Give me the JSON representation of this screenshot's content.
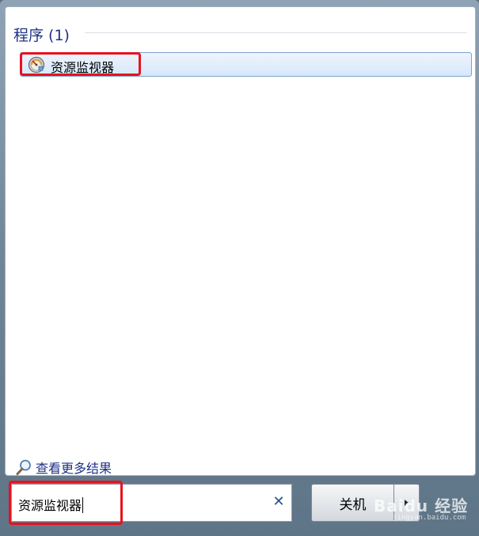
{
  "results": {
    "group_title": "程序 (1)",
    "items": [
      {
        "label": "资源监视器",
        "icon": "resource-monitor-icon"
      }
    ]
  },
  "see_more": {
    "label": "查看更多结果",
    "icon": "search-icon"
  },
  "search": {
    "value": "资源监视器",
    "clear_icon": "close-icon",
    "clear_glyph": "✕"
  },
  "power": {
    "shutdown_label": "关机",
    "arrow_icon": "chevron-right-icon"
  },
  "watermark": {
    "text": "Baidu 经验",
    "sub": "jingyan.baidu.com"
  },
  "colors": {
    "highlight": "#e8121f",
    "header_text": "#1e3287",
    "selected_bg": "#d6e7fb"
  }
}
